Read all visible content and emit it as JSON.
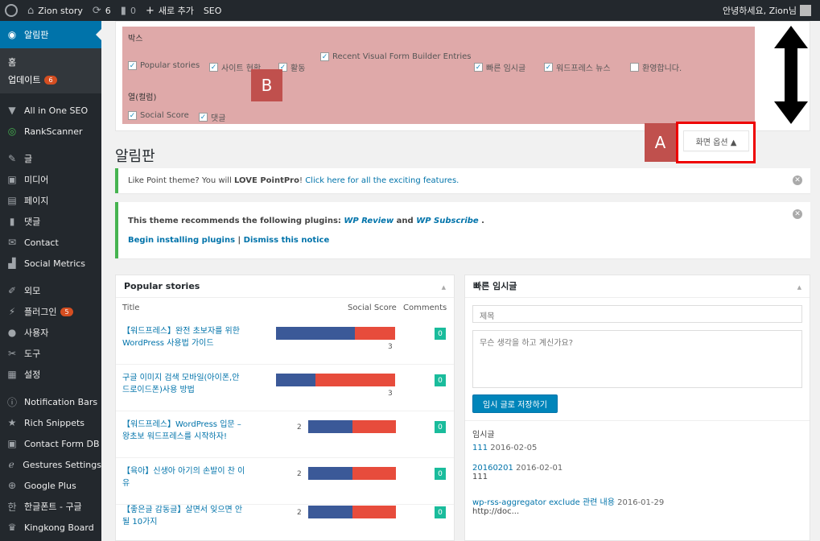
{
  "adminbar": {
    "site": "Zion story",
    "updates": "6",
    "comments": "0",
    "new": "새로 추가",
    "seo": "SEO",
    "greeting": "안녕하세요, Zion님"
  },
  "sidebar": {
    "current": "알림판",
    "sub": [
      "홈",
      "업데이트"
    ],
    "sub_badge": "6",
    "group1": [
      "All in One SEO",
      "RankScanner"
    ],
    "group2": [
      "글",
      "미디어",
      "페이지",
      "댓글",
      "Contact",
      "Social Metrics"
    ],
    "group3": [
      "외모",
      "플러그인",
      "사용자",
      "도구",
      "설정"
    ],
    "plugin_badge": "5",
    "group4": [
      "Notification Bars",
      "Rich Snippets",
      "Contact Form DB",
      "Gestures Settings",
      "Google Plus",
      "한글폰트 - 구글",
      "Kingkong Board"
    ]
  },
  "screen_options": {
    "boxes_heading": "박스",
    "boxes": [
      "Popular stories",
      "사이트 현황",
      "활동",
      "Recent Visual Form Builder Entries",
      "빠른 임시글",
      "워드프레스 뉴스",
      "환영합니다."
    ],
    "boxes_checked": [
      true,
      true,
      true,
      true,
      true,
      true,
      false
    ],
    "columns_heading": "열(컬럼)",
    "columns": [
      "Social Score",
      "댓글"
    ],
    "columns_checked": [
      true,
      true
    ],
    "button": "화면 옵션 ▲"
  },
  "annotations": {
    "a": "A",
    "b": "B"
  },
  "page_title": "알림판",
  "notice1": {
    "pre": "Like Point theme? You will ",
    "bold": "LOVE PointPro",
    "mid": "! ",
    "link": "Click here for all the exciting features."
  },
  "notice2": {
    "pre": "This theme recommends the following plugins: ",
    "p1": "WP Review",
    "and": " and ",
    "p2": "WP Subscribe",
    "end": " .",
    "install": "Begin installing plugins",
    "sep": " | ",
    "dismiss": "Dismiss this notice"
  },
  "popular": {
    "title": "Popular stories",
    "col_title": "Title",
    "col_score": "Social Score",
    "col_comments": "Comments",
    "rows": [
      {
        "t1": "【워드프레스】완전 초보자를 위한",
        "t2": "WordPress 사용법 가이드",
        "score": "3",
        "comments": "0",
        "blue": 0.66,
        "red": 0.34
      },
      {
        "t1": "구글 이미지 검색 모바일(아이폰,안",
        "t2": "드로이드폰)사용 방법",
        "score": "3",
        "comments": "0",
        "blue": 0.33,
        "red": 0.67
      },
      {
        "t1": "【워드프레스】WordPress 입문 –",
        "t2": "왕초보 워드프레스를 시작하자!",
        "score": "2",
        "comments": "0",
        "blue": 0.5,
        "red": 0.5
      },
      {
        "t1": "【육아】신생아 아기의 손발이 찬 이",
        "t2": "유",
        "score": "2",
        "comments": "0",
        "blue": 0.5,
        "red": 0.5
      },
      {
        "t1": "【좋은글 감동글】살면서 잊으면 안",
        "t2": "될 10가지",
        "score": "2",
        "comments": "0",
        "blue": 0.5,
        "red": 0.5
      }
    ]
  },
  "quickdraft": {
    "title": "빠른 임시글",
    "title_placeholder": "제목",
    "content_placeholder": "무슨 생각을 하고 계신가요?",
    "save": "임시 글로 저장하기",
    "drafts_heading": "임시글",
    "drafts": [
      {
        "link": "111",
        "date": "2016-02-05",
        "excerpt": ""
      },
      {
        "link": "20160201",
        "date": "2016-02-01",
        "excerpt": "111"
      },
      {
        "link": "wp-rss-aggregator exclude 관련 내용",
        "date": "2016-01-29",
        "excerpt": "http://doc..."
      }
    ]
  }
}
